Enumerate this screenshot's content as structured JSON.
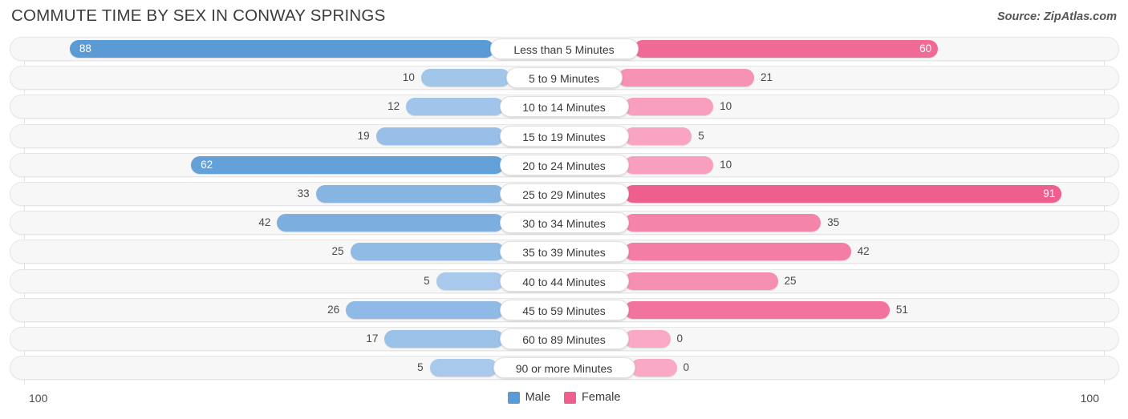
{
  "header": {
    "title": "COMMUTE TIME BY SEX IN CONWAY SPRINGS",
    "source": "Source: ZipAtlas.com"
  },
  "legend": {
    "male_label": "Male",
    "female_label": "Female",
    "male_color": "#5b9bd5",
    "female_color": "#ef5f8e"
  },
  "axis": {
    "left_tick": "100",
    "right_tick": "100",
    "max": 100
  },
  "chart_data": {
    "type": "bar",
    "title": "COMMUTE TIME BY SEX IN CONWAY SPRINGS",
    "subtitle": "Source: ZipAtlas.com",
    "orientation": "horizontal-diverging",
    "xlabel": "",
    "ylabel": "",
    "xlim": [
      100,
      100
    ],
    "grid": false,
    "legend_position": "bottom-center",
    "categories": [
      "Less than 5 Minutes",
      "5 to 9 Minutes",
      "10 to 14 Minutes",
      "15 to 19 Minutes",
      "20 to 24 Minutes",
      "25 to 29 Minutes",
      "30 to 34 Minutes",
      "35 to 39 Minutes",
      "40 to 44 Minutes",
      "45 to 59 Minutes",
      "60 to 89 Minutes",
      "90 or more Minutes"
    ],
    "series": [
      {
        "name": "Male",
        "values": [
          88,
          10,
          12,
          19,
          62,
          33,
          42,
          25,
          5,
          26,
          17,
          5
        ]
      },
      {
        "name": "Female",
        "values": [
          60,
          21,
          10,
          5,
          10,
          91,
          35,
          42,
          25,
          51,
          0,
          0
        ]
      }
    ]
  },
  "rows": [
    {
      "label": "Less than 5 Minutes",
      "male": "88",
      "female": "60"
    },
    {
      "label": "5 to 9 Minutes",
      "male": "10",
      "female": "21"
    },
    {
      "label": "10 to 14 Minutes",
      "male": "12",
      "female": "10"
    },
    {
      "label": "15 to 19 Minutes",
      "male": "19",
      "female": "5"
    },
    {
      "label": "20 to 24 Minutes",
      "male": "62",
      "female": "10"
    },
    {
      "label": "25 to 29 Minutes",
      "male": "33",
      "female": "91"
    },
    {
      "label": "30 to 34 Minutes",
      "male": "42",
      "female": "35"
    },
    {
      "label": "35 to 39 Minutes",
      "male": "25",
      "female": "42"
    },
    {
      "label": "40 to 44 Minutes",
      "male": "5",
      "female": "25"
    },
    {
      "label": "45 to 59 Minutes",
      "male": "26",
      "female": "51"
    },
    {
      "label": "60 to 89 Minutes",
      "male": "17",
      "female": "0"
    },
    {
      "label": "90 or more Minutes",
      "male": "5",
      "female": "0"
    }
  ]
}
